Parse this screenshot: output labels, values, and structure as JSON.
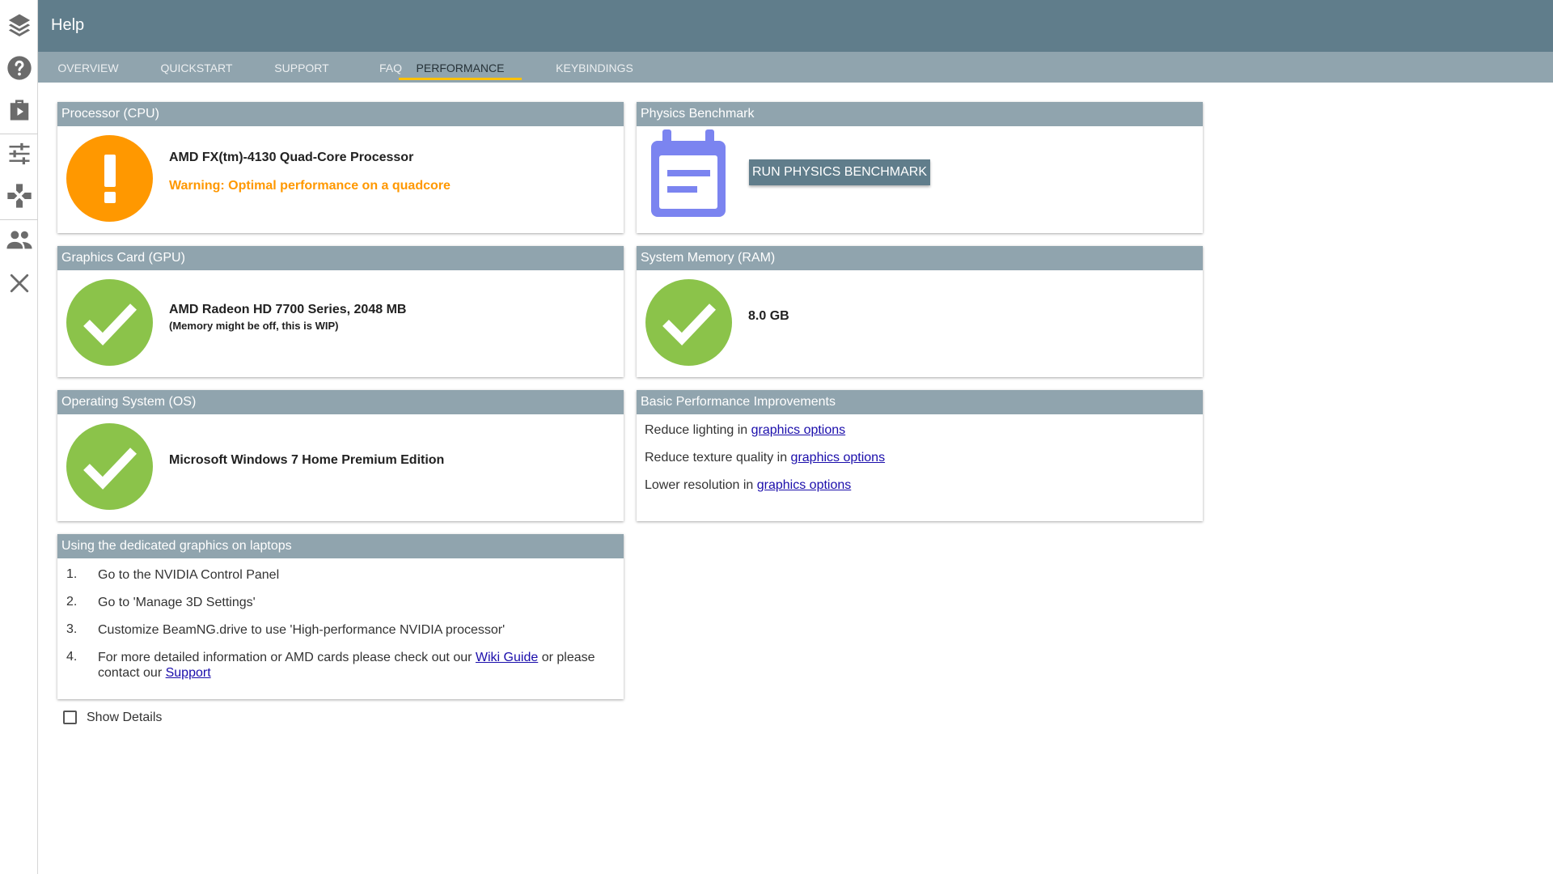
{
  "sidebar": {
    "items": [
      {
        "icon": "layers-icon"
      },
      {
        "icon": "help-icon"
      },
      {
        "icon": "play-icon"
      },
      {
        "icon": "sliders-icon"
      },
      {
        "icon": "gamepad-icon"
      },
      {
        "icon": "users-icon"
      },
      {
        "icon": "close-icon"
      }
    ]
  },
  "header": {
    "title": "Help"
  },
  "tabs": [
    {
      "label": "OVERVIEW"
    },
    {
      "label": "QUICKSTART"
    },
    {
      "label": "SUPPORT"
    },
    {
      "label": "FAQ"
    },
    {
      "label": "PERFORMANCE",
      "active": true
    },
    {
      "label": "KEYBINDINGS"
    }
  ],
  "cpu": {
    "title": "Processor (CPU)",
    "name": "AMD FX(tm)-4130 Quad-Core Processor",
    "warning": "Warning: Optimal performance on a quadcore",
    "status": "warning"
  },
  "physics": {
    "title": "Physics Benchmark",
    "button_label": "RUN PHYSICS BENCHMARK"
  },
  "gpu": {
    "title": "Graphics Card (GPU)",
    "name": "AMD Radeon HD 7700 Series, 2048 MB",
    "note": "(Memory might be off, this is WIP)",
    "status": "ok"
  },
  "ram": {
    "title": "System Memory (RAM)",
    "value": "8.0 GB",
    "status": "ok"
  },
  "os": {
    "title": "Operating System (OS)",
    "name": "Microsoft Windows 7 Home Premium Edition",
    "status": "ok"
  },
  "improvements": {
    "title": "Basic Performance Improvements",
    "tips": [
      {
        "text": "Reduce lighting in ",
        "link": "graphics options"
      },
      {
        "text": "Reduce texture quality in ",
        "link": "graphics options"
      },
      {
        "text": "Lower resolution in ",
        "link": "graphics options"
      }
    ]
  },
  "laptop": {
    "title": "Using the dedicated graphics on laptops",
    "steps": [
      {
        "num": "1.",
        "text": "Go to the NVIDIA Control Panel"
      },
      {
        "num": "2.",
        "text": "Go to 'Manage 3D Settings'"
      },
      {
        "num": "3.",
        "text": "Customize BeamNG.drive to use 'High-performance NVIDIA processor'"
      },
      {
        "num": "4.",
        "text_before": "For more detailed information or AMD cards please check out our ",
        "link1": "Wiki Guide",
        "text_middle": " or please contact our ",
        "link2": "Support"
      }
    ]
  },
  "details": {
    "label": "Show Details",
    "checked": false
  },
  "colors": {
    "header": "#607d8b",
    "tabs": "#90a4ae",
    "accent": "#ffc107",
    "warning": "#ff9800",
    "ok": "#8bc34a",
    "benchmark_icon": "#7b84f0"
  }
}
